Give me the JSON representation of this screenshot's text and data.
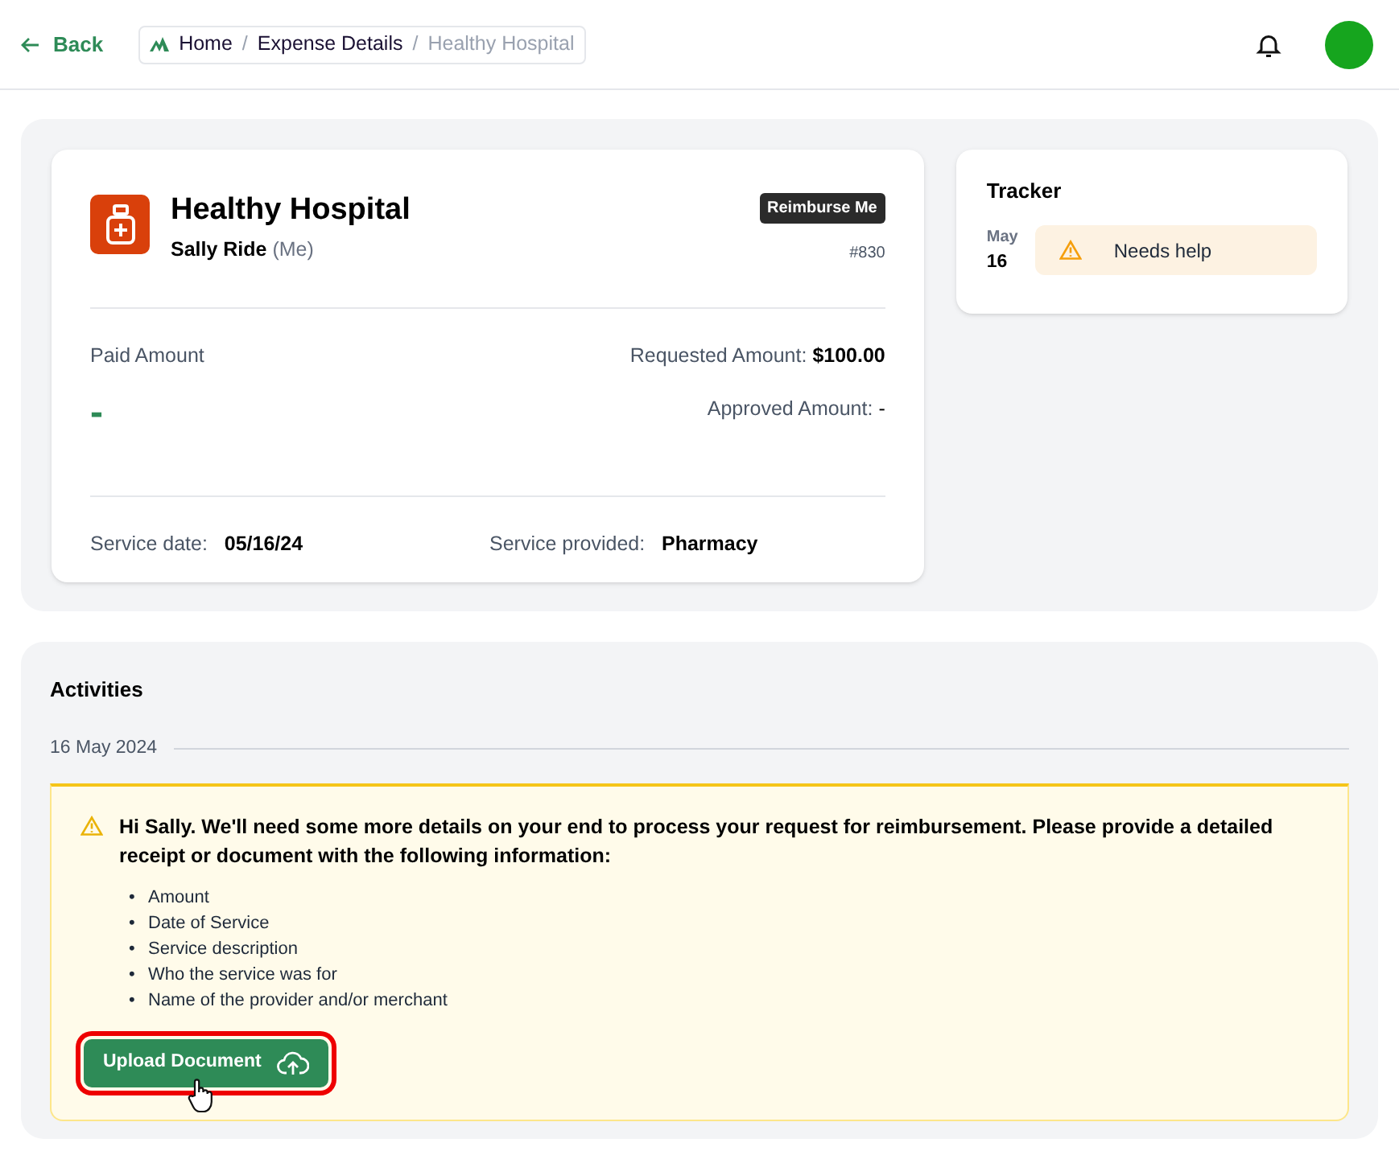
{
  "header": {
    "back": "Back",
    "breadcrumb": [
      {
        "label": "Home",
        "current": false
      },
      {
        "separator": "/",
        "label": "Expense Details",
        "current": false
      },
      {
        "separator": "/",
        "label": "Healthy Hospital",
        "current": true
      }
    ]
  },
  "expense": {
    "title": "Healthy Hospital",
    "person": "Sally Ride",
    "person_note": "(Me)",
    "badge": "Reimburse Me",
    "number": "#830",
    "paid_label": "Paid Amount",
    "paid_value": "-",
    "requested_label": "Requested Amount:",
    "requested_value": "$100.00",
    "approved_label": "Approved Amount:",
    "approved_value": "-",
    "service_date_label": "Service date:",
    "service_date": "05/16/24",
    "service_provided_label": "Service provided:",
    "service_provided": "Pharmacy"
  },
  "tracker": {
    "title": "Tracker",
    "entries": [
      {
        "month": "May",
        "day": "16",
        "status": "Needs help"
      }
    ]
  },
  "activities": {
    "title": "Activities",
    "date": "16 May 2024",
    "message": "Hi Sally. We'll need some more details on your end to process your request for reimbursement. Please provide a detailed receipt or document with the following information:",
    "items": [
      {
        "bullet": "•",
        "text": "Amount"
      },
      {
        "bullet": "•",
        "text": "Date of Service"
      },
      {
        "bullet": "•",
        "text": "Service description"
      },
      {
        "bullet": "•",
        "text": "Who the service was for"
      },
      {
        "bullet": "•",
        "text": "Name of the provider and/or merchant"
      }
    ],
    "button": "Upload Document"
  }
}
